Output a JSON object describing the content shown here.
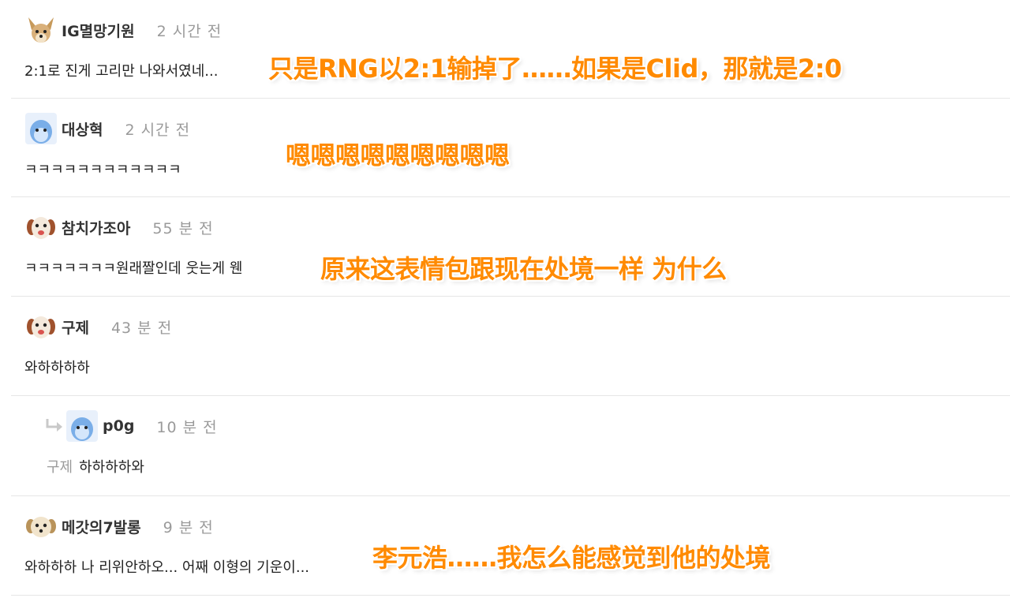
{
  "comments": [
    {
      "nickname": "IG멸망기원",
      "time": "2 시간 전",
      "text": "2:1로 진게 고리만 나와서였네...",
      "avatar_icon": "dog-avatar-icon"
    },
    {
      "nickname": "대상혁",
      "time": "2 시간 전",
      "text": "ㅋㅋㅋㅋㅋㅋㅋㅋㅋㅋㅋㅋ",
      "avatar_icon": "blue-creature-avatar-icon"
    },
    {
      "nickname": "참치가조아",
      "time": "55 분 전",
      "text": "ㅋㅋㅋㅋㅋㅋㅋ원래짤인데 웃는게 웬",
      "avatar_icon": "puppy-avatar-icon"
    },
    {
      "nickname": "구제",
      "time": "43 분 전",
      "text": "와하하하하",
      "avatar_icon": "puppy-avatar-icon"
    },
    {
      "nickname": "p0g",
      "time": "10 분 전",
      "reply_to": "구제",
      "text": "하하하하와",
      "avatar_icon": "blue-creature-avatar-icon"
    },
    {
      "nickname": "메갓의7발롱",
      "time": "9 분 전",
      "text": "와하하하 나 리위안하오... 어째 이형의 기운이...",
      "avatar_icon": "puppy-avatar-icon"
    }
  ],
  "overlays": [
    "只是RNG以2:1输掉了……如果是Clid，那就是2:0",
    "嗯嗯嗯嗯嗯嗯嗯嗯嗯",
    "原来这表情包跟现在处境一样  为什么",
    "李元浩……我怎么能感觉到他的处境"
  ],
  "colors": {
    "overlay_text": "#ff8a00",
    "meta_text": "#9a9a9a",
    "divider": "#e6e6e6"
  }
}
